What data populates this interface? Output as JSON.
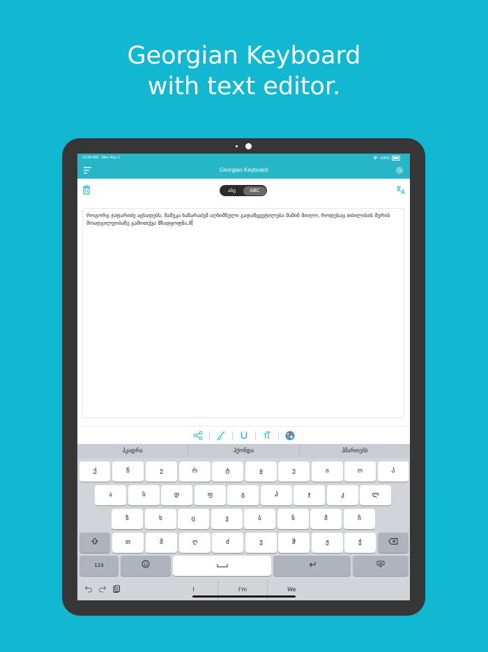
{
  "headline": {
    "line1": "Georgian Keyboard",
    "line2": "with text editor."
  },
  "status_bar": {
    "time": "11:08 AM",
    "date": "Mon Nov 1",
    "battery": "100%"
  },
  "nav": {
    "title": "Georgian Keyboard"
  },
  "toolbar": {
    "segments": [
      "აბგ",
      "ABC"
    ],
    "active_segment": "ABC"
  },
  "editor": {
    "text": "როგორც ჯაფარიძე აცხადებს, მამუკა ხაზარაძემ აღნიშნული გადაწყვეტილება მაშინ მიიღო, როდესაც თბილისის მერის მოადგილეობაზე გამოთქვა მზადყოფნა.მ"
  },
  "suggestions": [
    "ჰკადრა",
    "ჰქონდა",
    "ჰმართებს"
  ],
  "keyboard": {
    "row1": [
      "ქ",
      "წ",
      "ე",
      "რ",
      "ტ",
      "ყ",
      "უ",
      "ი",
      "ო",
      "პ"
    ],
    "row2": [
      "ა",
      "ს",
      "დ",
      "ფ",
      "გ",
      "ჰ",
      "ჯ",
      "კ",
      "ლ"
    ],
    "row3": [
      "ზ",
      "ხ",
      "ც",
      "ვ",
      "ბ",
      "ნ",
      "მ",
      "ჩ"
    ],
    "row4": [
      "თ",
      "შ",
      "ღ",
      "ძ",
      "ჳ",
      "ჵ",
      "ჟ",
      "ჭ"
    ],
    "numbers_label": "123"
  },
  "predictions": [
    "I",
    "I'm",
    "We"
  ],
  "colors": {
    "background": "#12b8d1",
    "accent": "#26b6c8",
    "icon": "#26b6c8"
  }
}
